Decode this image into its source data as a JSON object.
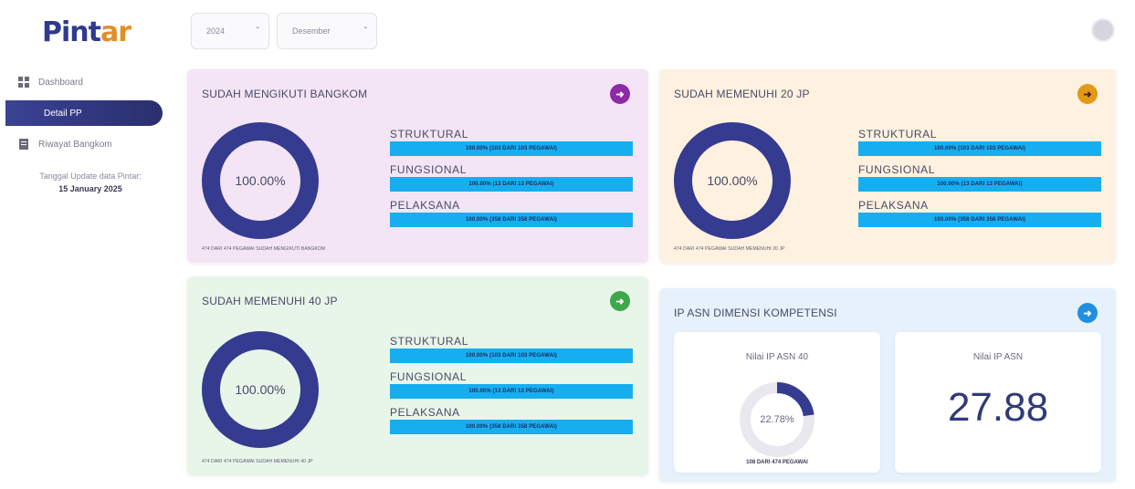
{
  "logo": {
    "main": "Pint",
    "accent": "ar"
  },
  "sidebar": {
    "items": [
      {
        "label": "Dashboard",
        "icon": "grid-icon"
      },
      {
        "label": "Detail PP",
        "icon": "none"
      },
      {
        "label": "Riwayat Bangkom",
        "icon": "document-icon"
      }
    ],
    "update_label": "Tanggal Update data Pintar:",
    "update_date": "15 January 2025"
  },
  "filters": {
    "year": "2024",
    "month": "Desember"
  },
  "colors": {
    "primary": "#2f3a8f",
    "bar": "#17aef0",
    "donut": "#353b8f",
    "card1_bg": "#f3e5f5",
    "card2_bg": "#fff1e0",
    "card3_bg": "#e8f5e9",
    "card4_bg": "#e6f1fb"
  },
  "cards": [
    {
      "title": "SUDAH MENGIKUTI BANGKOM",
      "button_icon": "arrow-icon",
      "button_color": "#8e2aa8",
      "percent": "100.00%",
      "percent_value": 100,
      "rows": [
        {
          "label": "STRUKTURAL",
          "bar": "100.00% (103 DARI 103 PEGAWAI)"
        },
        {
          "label": "FUNGSIONAL",
          "bar": "100.00% (13 DARI 13 PEGAWAI)"
        },
        {
          "label": "PELAKSANA",
          "bar": "100.00% (358 DARI 358 PEGAWAI)"
        }
      ],
      "footer": "474 DARI 474 PEGAWAI SUDAH MENGIKUTI BANGKOM"
    },
    {
      "title": "SUDAH MEMENUHI 20 JP",
      "button_icon": "arrow-icon",
      "button_color": "#e09a16",
      "percent": "100.00%",
      "percent_value": 100,
      "rows": [
        {
          "label": "STRUKTURAL",
          "bar": "100.00% (103 DARI 103 PEGAWAI)"
        },
        {
          "label": "FUNGSIONAL",
          "bar": "100.00% (13 DARI 13 PEGAWAI)"
        },
        {
          "label": "PELAKSANA",
          "bar": "100.00% (358 DARI 358 PEGAWAI)"
        }
      ],
      "footer": "474 DARI 474 PEGAWAI SUDAH MEMENUHI 20 JP"
    },
    {
      "title": "SUDAH MEMENUHI 40 JP",
      "button_icon": "arrow-icon",
      "button_color": "#3ca84a",
      "percent": "100.00%",
      "percent_value": 100,
      "rows": [
        {
          "label": "STRUKTURAL",
          "bar": "100.00% (103 DARI 103 PEGAWAI)"
        },
        {
          "label": "FUNGSIONAL",
          "bar": "100.00% (13 DARI 13 PEGAWAI)"
        },
        {
          "label": "PELAKSANA",
          "bar": "100.00% (358 DARI 358 PEGAWAI)"
        }
      ],
      "footer": "474 DARI 474 PEGAWAI SUDAH MEMENUHI 40 JP"
    }
  ],
  "ipasn": {
    "title": "IP ASN DIMENSI KOMPETENSI",
    "button_icon": "arrow-icon",
    "button_color": "#1f8fe0",
    "left": {
      "title": "Nilai IP ASN 40",
      "percent": "22.78%",
      "percent_value": 22.78,
      "footer": "108 DARI 474 PEGAWAI"
    },
    "right": {
      "title": "Nilai IP ASN",
      "value": "27.88"
    }
  }
}
